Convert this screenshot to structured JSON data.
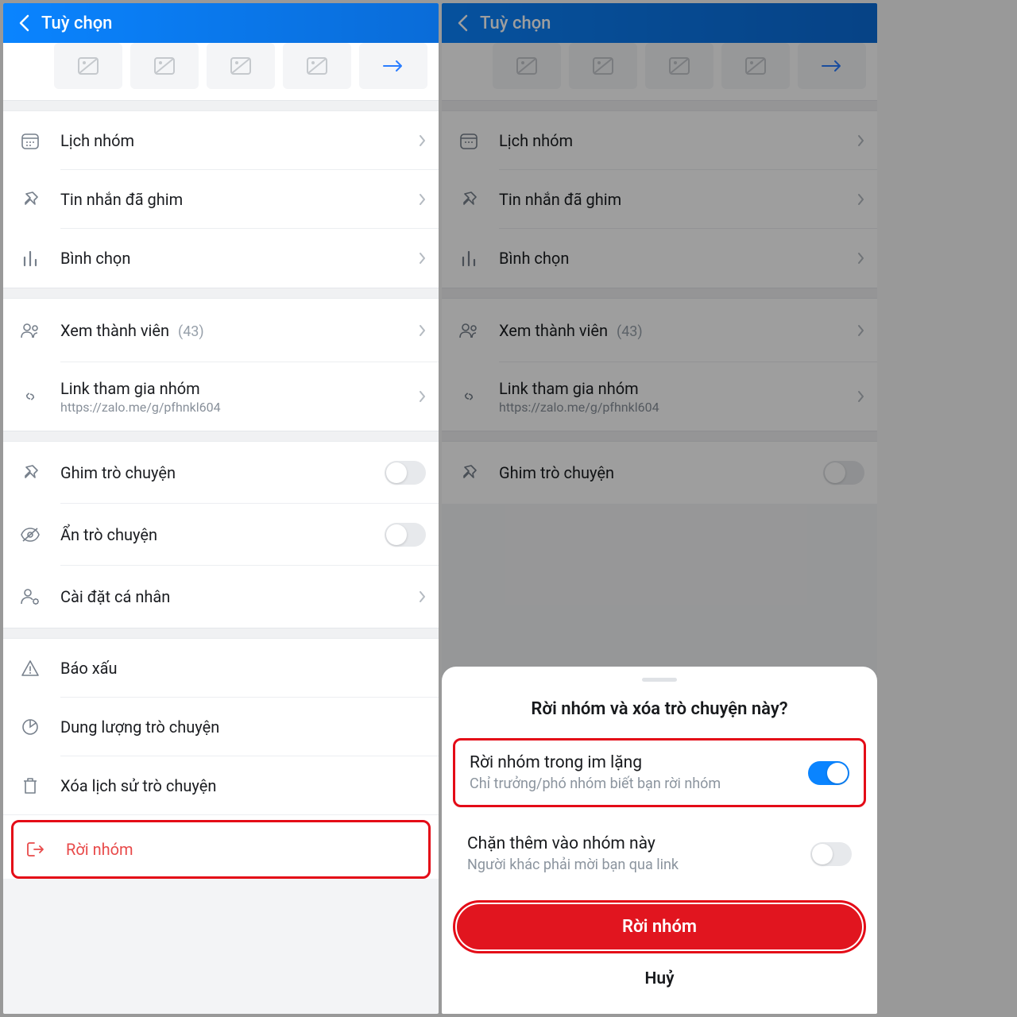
{
  "header": {
    "title": "Tuỳ chọn"
  },
  "rows": {
    "calendar": "Lịch nhóm",
    "pinned": "Tin nhắn đã ghim",
    "poll": "Bình chọn",
    "members_label": "Xem thành viên",
    "members_count": "(43)",
    "link_label": "Link tham gia nhóm",
    "link_url": "https://zalo.me/g/pfhnkl604",
    "pin_chat": "Ghim trò chuyện",
    "hide_chat": "Ẩn trò chuyện",
    "personal": "Cài đặt cá nhân",
    "report": "Báo xấu",
    "storage": "Dung lượng trò chuyện",
    "clear": "Xóa lịch sử trò chuyện",
    "leave": "Rời nhóm"
  },
  "sheet": {
    "title": "Rời nhóm và xóa trò chuyện này?",
    "opt1_label": "Rời nhóm trong im lặng",
    "opt1_sub": "Chỉ trưởng/phó nhóm biết bạn rời nhóm",
    "opt2_label": "Chặn thêm vào nhóm này",
    "opt2_sub": "Người khác phải mời bạn qua link",
    "leave_btn": "Rời nhóm",
    "cancel": "Huỷ"
  }
}
